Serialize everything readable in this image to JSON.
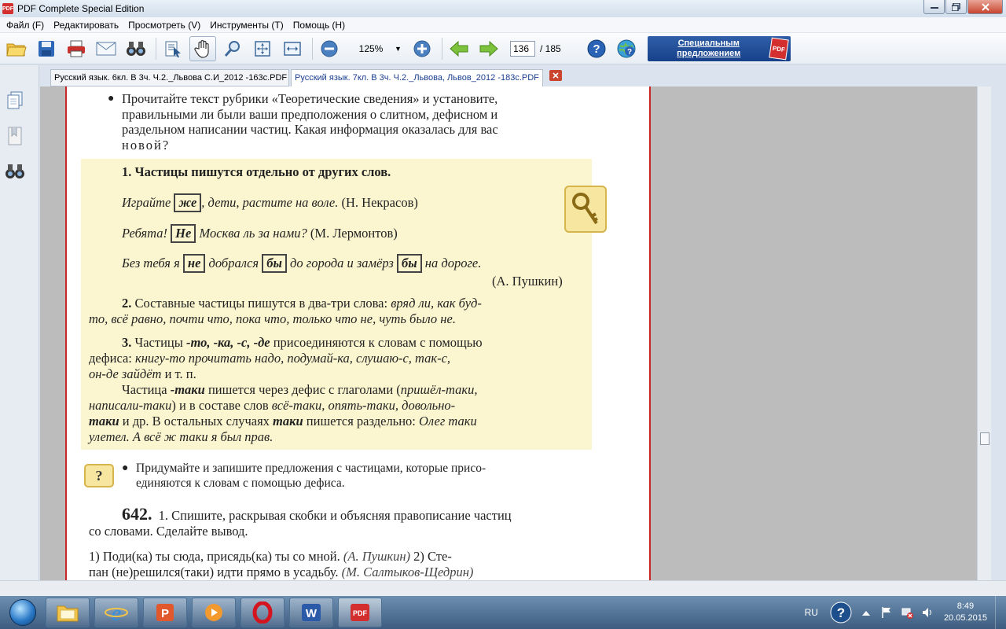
{
  "window": {
    "title": "PDF Complete Special Edition",
    "app_icon": "PDF"
  },
  "menu": [
    "Файл (F)",
    "Редактировать",
    "Просмотреть (V)",
    "Инструменты (T)",
    "Помощь (H)"
  ],
  "toolbar": {
    "zoom": "125%",
    "page_current": "136",
    "page_total": "/ 185",
    "promo_label": "Специальным предложением",
    "promo_badge": "PDF"
  },
  "tabs": {
    "inactive": "Русский язык. 6кл. В 3ч. Ч.2._Львова С.И_2012 -163с.PDF",
    "active": "Русский язык. 7кл. В 3ч. Ч.2._Львова, Львов_2012 -183с.PDF",
    "close": "x"
  },
  "document": {
    "intro": [
      "Прочитайте текст рубрики «Теоретические сведения» и установите,",
      "правильными ли были ваши предположения о слитном, дефисном и",
      "раздельном написании частиц. Какая информация оказалась для вас",
      "новой?"
    ],
    "rule1_title": "1. Частицы пишутся отдельно от других слов.",
    "ex1_a": "Играйте",
    "ex1_box": "же",
    "ex1_b": ", дети, растите на воле.",
    "ex1_src": "(Н. Некрасов)",
    "ex2_a": "Ребята!",
    "ex2_box": "Не",
    "ex2_b": "Москва ль за нами?",
    "ex2_src": "(М. Лермонтов)",
    "ex3_a": "Без тебя я",
    "ex3_box1": "не",
    "ex3_b": "добрался",
    "ex3_box2": "бы",
    "ex3_c": "до города и замёрз",
    "ex3_box3": "бы",
    "ex3_d": "на дороге.",
    "ex3_src": "(А. Пушкин)",
    "rule2_a": "2.",
    "rule2_text": "Составные частицы пишутся в два-три слова:",
    "rule2_ex1": "вряд ли, как буд-",
    "rule2_ex2": "то, всё равно, почти что, пока что, только что не, чуть было не.",
    "rule3_line1_a": "3.",
    "rule3_line1_b": "Частицы",
    "rule3_line1_c": "-то, -ка, -с, -де",
    "rule3_line1_d": "присоединяются к словам с помощью",
    "rule3_line2_a": "дефиса:",
    "rule3_line2_b": "книгу-то прочитать надо, подумай-ка, слушаю-с, так-с,",
    "rule3_line3_a": "он-де зайдёт",
    "rule3_line3_b": "и т. п.",
    "taki_line1_a": "Частица",
    "taki_line1_b": "-таки",
    "taki_line1_c": "пишется через дефис с глаголами (",
    "taki_line1_d": "пришёл-таки,",
    "taki_line2_a": "написали-таки",
    "taki_line2_b": ") и в составе слов",
    "taki_line2_c": "всё-таки, опять-таки, довольно-",
    "taki_line3_a": "таки",
    "taki_line3_b": "и др. В остальных случаях",
    "taki_line3_c": "таки",
    "taki_line3_d": "пишется раздельно:",
    "taki_line3_e": "Олег таки",
    "taki_line4": "улетел. А всё ж таки я был прав.",
    "task_line1": "Придумайте и запишите предложения с частицами, которые присо-",
    "task_line2": "единяются к словам с помощью дефиса.",
    "ex642_num": "642.",
    "ex642_line1": "1. Спишите, раскрывая скобки и объясняя правописание частиц",
    "ex642_line2": "со словами. Сделайте вывод.",
    "ex642_line3_a": "1) Поди(ка) ты сюда, присядь(ка) ты со мной.",
    "ex642_line3_b": "(А. Пушкин)",
    "ex642_line3_c": "2) Сте-",
    "ex642_line4_a": "пан (не)решился(таки) идти прямо в усадьбу.",
    "ex642_line4_b": "(М. Салтыков-Щедрин)",
    "q_icon": "?"
  },
  "taskbar": {
    "lang": "RU",
    "time": "8:49",
    "date": "20.05.2015",
    "apps": [
      "folder-icon",
      "ie-icon",
      "powerpoint-icon",
      "media-icon",
      "opera-icon",
      "word-icon",
      "pdf-icon"
    ],
    "word_label": "W",
    "pdf_label": "PDF",
    "opera_label": "O"
  },
  "colors": {
    "page_border": "#c62828",
    "theory_bg": "#fbf6cf",
    "promo": "#17408a"
  }
}
